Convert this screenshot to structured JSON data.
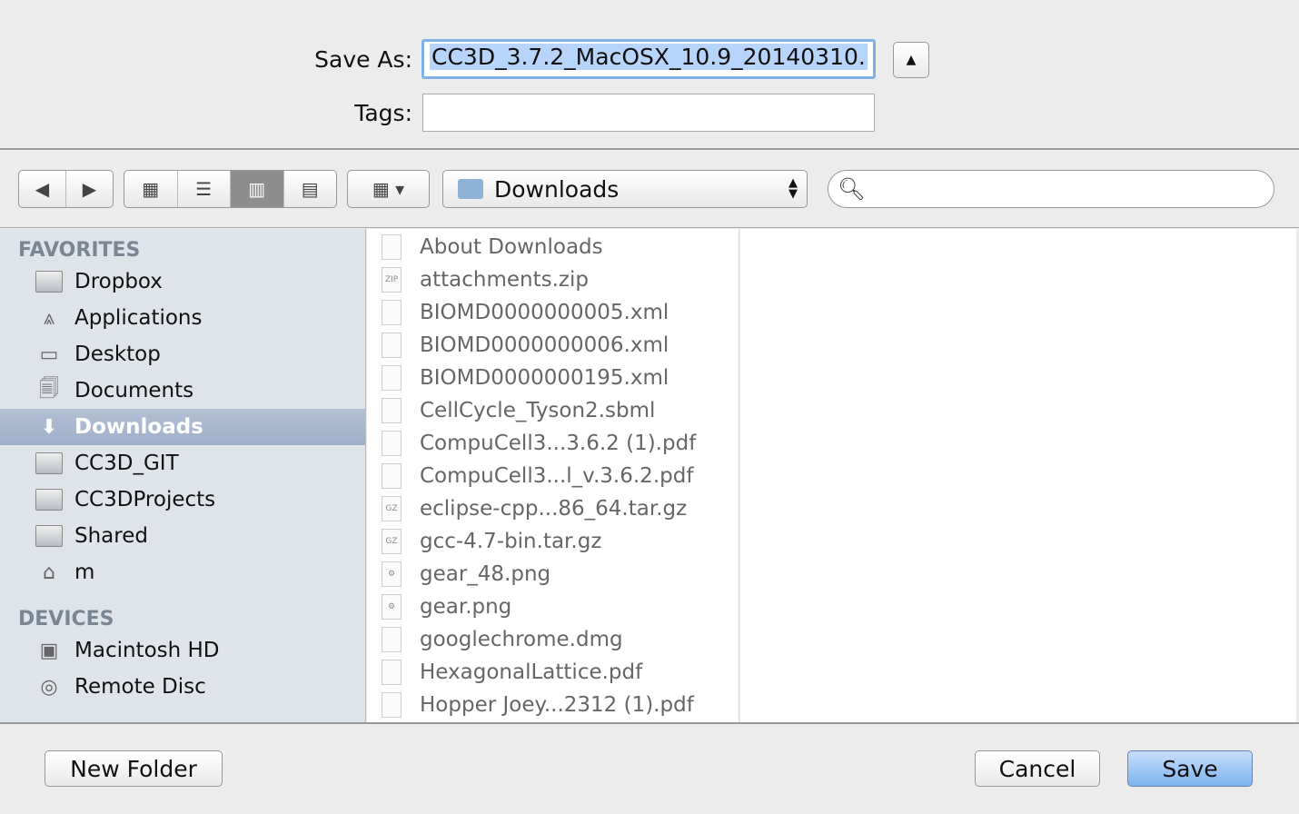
{
  "save_as": {
    "label": "Save As:",
    "value": "CC3D_3.7.2_MacOSX_10.9_20140310."
  },
  "tags": {
    "label": "Tags:",
    "value": ""
  },
  "toolbar": {
    "location": "Downloads",
    "search_placeholder": ""
  },
  "sidebar": {
    "favorites_header": "FAVORITES",
    "favorites": [
      {
        "label": "Dropbox",
        "icon": "folder-icon"
      },
      {
        "label": "Applications",
        "icon": "applications-icon"
      },
      {
        "label": "Desktop",
        "icon": "desktop-icon"
      },
      {
        "label": "Documents",
        "icon": "documents-icon"
      },
      {
        "label": "Downloads",
        "icon": "downloads-icon",
        "selected": true
      },
      {
        "label": "CC3D_GIT",
        "icon": "folder-icon"
      },
      {
        "label": "CC3DProjects",
        "icon": "folder-icon"
      },
      {
        "label": "Shared",
        "icon": "folder-icon"
      },
      {
        "label": "m",
        "icon": "home-icon"
      }
    ],
    "devices_header": "DEVICES",
    "devices": [
      {
        "label": "Macintosh HD",
        "icon": "hard-disk-icon"
      },
      {
        "label": "Remote Disc",
        "icon": "disc-icon"
      }
    ]
  },
  "files": [
    "About Downloads",
    "attachments.zip",
    "BIOMD0000000005.xml",
    "BIOMD0000000006.xml",
    "BIOMD0000000195.xml",
    "CellCycle_Tyson2.sbml",
    "CompuCell3...3.6.2 (1).pdf",
    "CompuCell3...l_v.3.6.2.pdf",
    "eclipse-cpp...86_64.tar.gz",
    "gcc-4.7-bin.tar.gz",
    "gear_48.png",
    "gear.png",
    "googlechrome.dmg",
    "HexagonalLattice.pdf",
    "Hopper Joey...2312 (1).pdf"
  ],
  "buttons": {
    "new_folder": "New Folder",
    "cancel": "Cancel",
    "save": "Save"
  },
  "colors": {
    "accent": "#7fb0e6",
    "selection": "#b7d5fb",
    "sidebar_selected": "#a5b5cc"
  }
}
